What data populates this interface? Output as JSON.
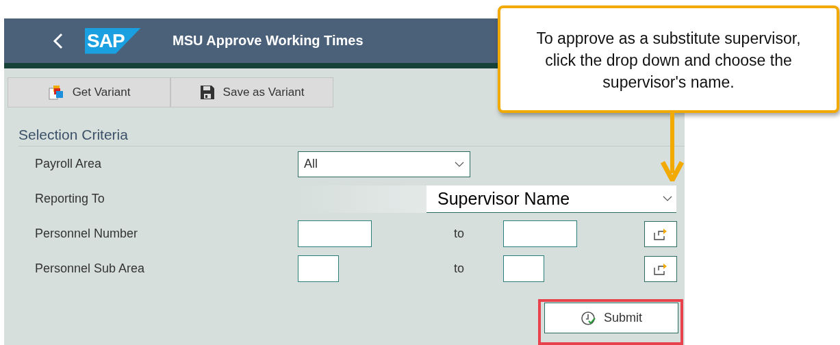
{
  "header": {
    "logo": "SAP",
    "title": "MSU Approve Working Times"
  },
  "toolbar": [
    {
      "label": "Get Variant",
      "kind": "get"
    },
    {
      "label": "Save as Variant",
      "kind": "save"
    }
  ],
  "section": {
    "title": "Selection Criteria"
  },
  "fields": [
    {
      "label": "Payroll Area",
      "kind": "dropdown",
      "value": "All"
    },
    {
      "label": "Reporting To",
      "kind": "big-dropdown",
      "value": "Supervisor Name"
    },
    {
      "label": "Personnel Number",
      "kind": "range",
      "to": "to"
    },
    {
      "label": "Personnel Sub Area",
      "kind": "short-range",
      "to": "to"
    }
  ],
  "submit": {
    "label": "Submit",
    "highlighted": true
  },
  "callout": {
    "text": "To approve as a substitute supervisor, click the drop down and choose the supervisor's name."
  }
}
